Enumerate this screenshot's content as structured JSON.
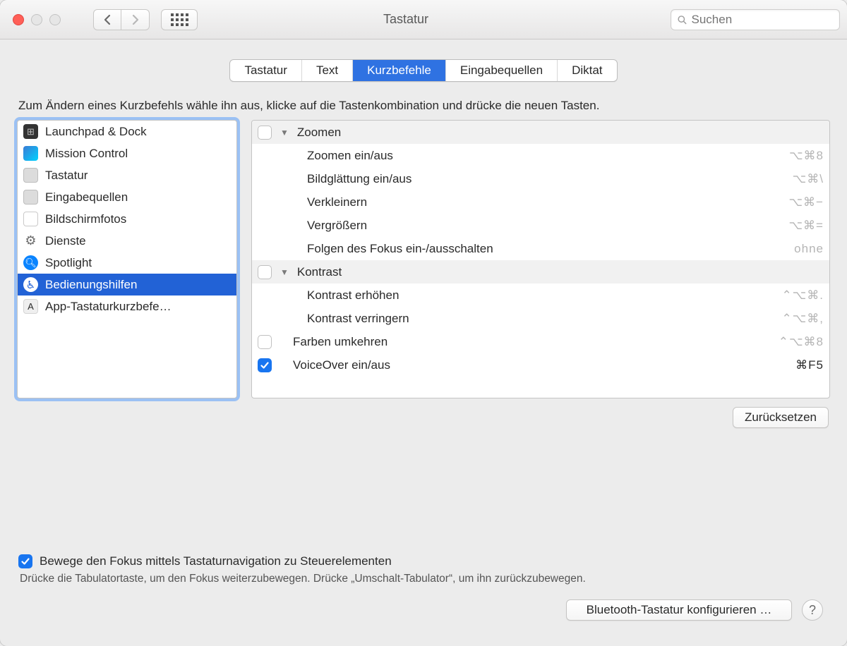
{
  "window": {
    "title": "Tastatur"
  },
  "search": {
    "placeholder": "Suchen"
  },
  "tabs": [
    {
      "label": "Tastatur",
      "active": false
    },
    {
      "label": "Text",
      "active": false
    },
    {
      "label": "Kurzbefehle",
      "active": true
    },
    {
      "label": "Eingabequellen",
      "active": false
    },
    {
      "label": "Diktat",
      "active": false
    }
  ],
  "instructions": "Zum Ändern eines Kurzbefehls wähle ihn aus, klicke auf die Tastenkombination und drücke die neuen Tasten.",
  "categories": [
    {
      "label": "Launchpad & Dock",
      "icon": "launchpad",
      "selected": false
    },
    {
      "label": "Mission Control",
      "icon": "mission",
      "selected": false
    },
    {
      "label": "Tastatur",
      "icon": "keyboard",
      "selected": false
    },
    {
      "label": "Eingabequellen",
      "icon": "input",
      "selected": false
    },
    {
      "label": "Bildschirmfotos",
      "icon": "screenshot",
      "selected": false
    },
    {
      "label": "Dienste",
      "icon": "gear",
      "selected": false
    },
    {
      "label": "Spotlight",
      "icon": "spotlight",
      "selected": false
    },
    {
      "label": "Bedienungshilfen",
      "icon": "a11y",
      "selected": true
    },
    {
      "label": "App-Tastaturkurzbefe…",
      "icon": "app",
      "selected": false
    }
  ],
  "shortcuts": {
    "groups": [
      {
        "header": "Zoomen",
        "header_checked": false,
        "items": [
          {
            "label": "Zoomen ein/aus",
            "shortcut": "⌥⌘8",
            "dark": false
          },
          {
            "label": "Bildglättung ein/aus",
            "shortcut": "⌥⌘\\",
            "dark": false
          },
          {
            "label": "Verkleinern",
            "shortcut": "⌥⌘−",
            "dark": false
          },
          {
            "label": "Vergrößern",
            "shortcut": "⌥⌘=",
            "dark": false
          },
          {
            "label": "Folgen des Fokus ein-/ausschalten",
            "shortcut": "ohne",
            "dark": false
          }
        ]
      },
      {
        "header": "Kontrast",
        "header_checked": false,
        "items": [
          {
            "label": "Kontrast erhöhen",
            "shortcut": "⌃⌥⌘.",
            "dark": false
          },
          {
            "label": "Kontrast verringern",
            "shortcut": "⌃⌥⌘,",
            "dark": false
          }
        ]
      }
    ],
    "flat": [
      {
        "label": "Farben umkehren",
        "checked": false,
        "shortcut": "⌃⌥⌘8",
        "dark": false
      },
      {
        "label": "VoiceOver ein/aus",
        "checked": true,
        "shortcut": "⌘F5",
        "dark": true
      }
    ]
  },
  "reset_button": "Zurücksetzen",
  "focus": {
    "checked": true,
    "label": "Bewege den Fokus mittels Tastaturnavigation zu Steuerelementen",
    "sub": "Drücke die Tabulatortaste, um den Fokus weiterzubewegen. Drücke „Umschalt-Tabulator“, um ihn zurückzubewegen."
  },
  "bluetooth_button": "Bluetooth-Tastatur konfigurieren …"
}
